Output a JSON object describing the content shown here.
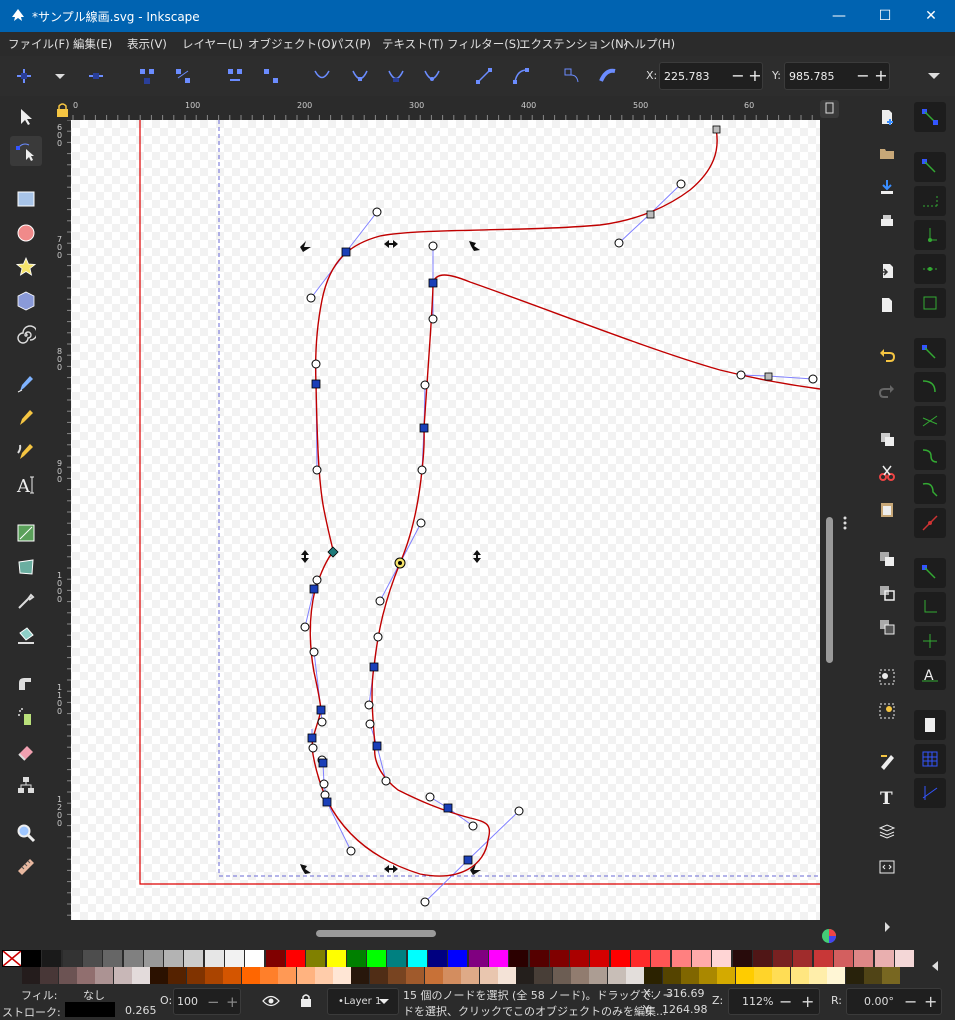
{
  "window": {
    "title": "*サンプル線画.svg - Inkscape",
    "minimize": "—",
    "maximize": "☐",
    "close": "✕"
  },
  "menu": [
    "ファイル(F)",
    "編集(E)",
    "表示(V)",
    "レイヤー(L)",
    "オブジェクト(O)",
    "パス(P)",
    "テキスト(T)",
    "フィルター(S)",
    "エクステンション(N)",
    "ヘルプ(H)"
  ],
  "toolbar": {
    "x_label": "X:",
    "x_value": "225.783",
    "y_label": "Y:",
    "y_value": "985.785",
    "minus": "−",
    "plus": "+"
  },
  "rulers": {
    "h_ticks": [
      "0",
      "100",
      "200",
      "300",
      "400",
      "500",
      "60"
    ],
    "v_ticks": [
      "6\n0\n0",
      "7\n0\n0",
      "8\n0\n0",
      "9\n0\n0",
      "1\n0\n0\n0",
      "1\n1\n0\n0",
      "1\n2\n0\n0"
    ]
  },
  "palette": {
    "colors": [
      "#000000",
      "#1a1a1a",
      "#333333",
      "#4d4d4d",
      "#666666",
      "#808080",
      "#999999",
      "#b3b3b3",
      "#cccccc",
      "#e6e6e6",
      "#f2f2f2",
      "#ffffff",
      "#800000",
      "#ff0000",
      "#808000",
      "#ffff00",
      "#008000",
      "#00ff00",
      "#008080",
      "#00ffff",
      "#000080",
      "#0000ff",
      "#800080",
      "#ff00ff",
      "#2b0000",
      "#550000",
      "#800000",
      "#aa0000",
      "#d40000",
      "#ff0000",
      "#ff2a2a",
      "#ff5555",
      "#ff8080",
      "#ffaaaa",
      "#ffd5d5",
      "#280b0b",
      "#501616",
      "#782121",
      "#a02c2c",
      "#c83737",
      "#d35f5f",
      "#de8787",
      "#e9afaf",
      "#f4d7d7"
    ],
    "colors2": [
      "#241c1c",
      "#483737",
      "#6c5353",
      "#916f6f",
      "#ac9393",
      "#c8b7b7",
      "#e3dbdb",
      "#2b1100",
      "#552200",
      "#803300",
      "#aa4400",
      "#d45500",
      "#ff6600",
      "#ff7f2a",
      "#ff9955",
      "#ffb380",
      "#ffccaa",
      "#ffe6d5",
      "#28170b",
      "#502d16",
      "#784421",
      "#a05a2c",
      "#c87137",
      "#d38d5f",
      "#deaa87",
      "#e9c6af",
      "#f4e3d7",
      "#241f1c",
      "#483e37",
      "#6c5d53",
      "#917c6f",
      "#ac9d93",
      "#c8beb7",
      "#e3dedb",
      "#2b2200",
      "#554400",
      "#806600",
      "#aa8800",
      "#d4aa00",
      "#ffcc00",
      "#ffd42a",
      "#ffdd55",
      "#ffe680",
      "#ffeeaa",
      "#fff6d5",
      "#28220b",
      "#504416",
      "#786721"
    ]
  },
  "status": {
    "fill_label": "フィル:",
    "fill_value": "なし",
    "stroke_label": "ストローク:",
    "stroke_width": "0.265",
    "opacity_label": "O:",
    "opacity_value": "100",
    "layer": "•Layer 1",
    "message_line1": "15 個のノードを選択 (全 58 ノード)。ドラッグでノー",
    "message_line2": "ドを選択、クリックでこのオブジェクトのみを編集...",
    "cx_label": "X:",
    "cx_value": "316.69",
    "cy_label": "Y:",
    "cy_value": "1264.98",
    "zoom_label": "Z:",
    "zoom_value": "112%",
    "rot_label": "R:",
    "rot_value": "0.00°"
  },
  "colors": {
    "path_stroke": "#c00000",
    "handle_line": "#8080ff",
    "node_selected": "#1a3fb8",
    "page_border": "#dd0000",
    "guide": "#6b6bd6",
    "accent": "#0063b1"
  }
}
